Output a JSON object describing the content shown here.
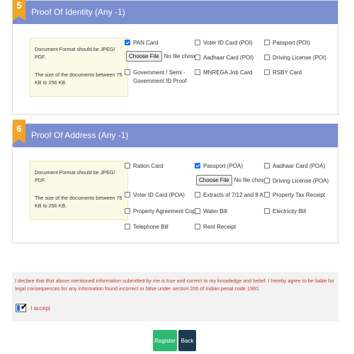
{
  "identity": {
    "number": "5",
    "title": "Proof Of Identity (Any -1)",
    "info_format": "Document Format should be JPEG/ PDF.",
    "info_size": "The size of the documents between 75 KB to 256 KB.",
    "options": {
      "pan": "PAN Card",
      "voter": "Voter ID Card (POI)",
      "passport": "Passport (POI)",
      "aadhaar": "Aadhaar Card (POI)",
      "driving": "Driving License (POI)",
      "govt": "Government / Semi - Government ID Proof",
      "mnrega": "MNREGA Job Card",
      "rsby": "RSBY Card"
    },
    "file_button": "Choose File",
    "file_status": "No file chosen"
  },
  "address": {
    "number": "6",
    "title": "Proof Of Address (Any -1)",
    "info_format": "Document Format should be JPEG/ PDF.",
    "info_size": "The size of the documents between 75 KB to 256 KB.",
    "options": {
      "ration": "Ration Card",
      "passport": "Passport (POA)",
      "aadhaar": "Aadhaar Card (POA)",
      "driving": "Driving License (POA)",
      "voter": "Voter ID Card (POA)",
      "extracts": "Extracts of 7/12 and 8 A",
      "property_tax": "Property Tax Receipt",
      "agreement": "Property Agreement Copy",
      "water": "Water Bill",
      "electricity": "Electricity Bill",
      "telephone": "Telephone Bill",
      "rent": "Rent Receipt"
    },
    "file_button": "Choose File",
    "file_status": "No file chosen"
  },
  "declaration": {
    "text": "I declare that that above mentioned information submitted by me is true and correct to my knowledge and belief. I hereby agree to be liable for legal consequences for any information found incorrect or false under section 200 of Indian penal code 1960.",
    "accept_label": "I accept"
  },
  "buttons": {
    "register": "Register",
    "back": "Back"
  },
  "colors": {
    "header": "#7b8ed0",
    "badge": "#f0a526",
    "info_bg": "#fdf9e7",
    "declaration_text": "#c0392b",
    "register": "#2eb872",
    "back": "#1d3a52",
    "checkbox_checked": "#1a73e8"
  }
}
